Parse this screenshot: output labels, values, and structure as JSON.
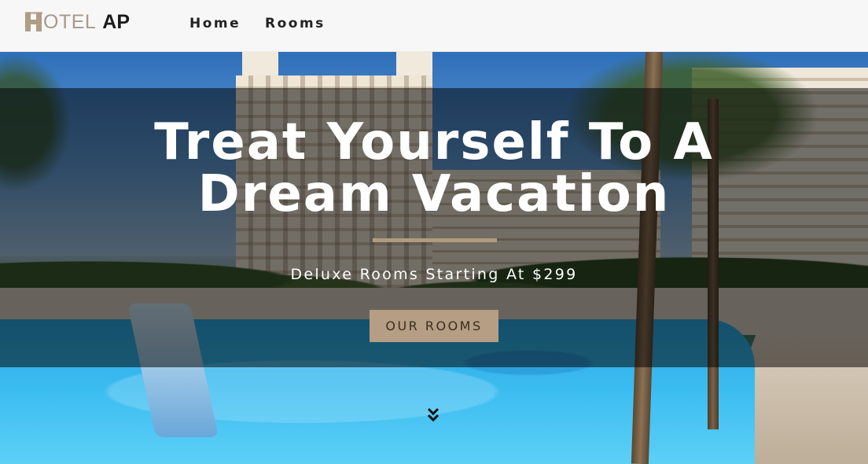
{
  "navbar": {
    "brand_prefix": "OTEL",
    "brand_suffix": "AP",
    "links": [
      {
        "label": "Home"
      },
      {
        "label": "Rooms"
      }
    ]
  },
  "hero": {
    "headline_line1": "Treat Yourself To A",
    "headline_line2": "Dream Vacation",
    "subheadline": "Deluxe Rooms Starting At $299",
    "cta_label": "OUR ROOMS",
    "scroll_icon": "double-chevron-down-icon"
  },
  "colors": {
    "accent": "#b59e84",
    "divider": "#b09b7e",
    "navbar_bg": "#f7f7f7",
    "overlay": "rgba(0,0,0,0.52)"
  }
}
